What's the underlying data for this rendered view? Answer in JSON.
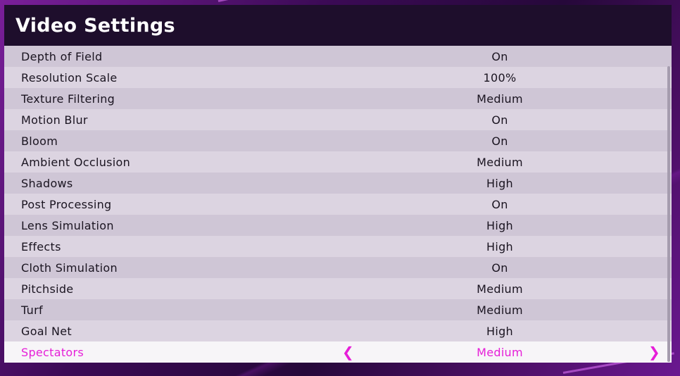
{
  "header": {
    "title": "Video Settings"
  },
  "settings": [
    {
      "label": "Depth of Field",
      "value": "On"
    },
    {
      "label": "Resolution Scale",
      "value": "100%"
    },
    {
      "label": "Texture Filtering",
      "value": "Medium"
    },
    {
      "label": "Motion Blur",
      "value": "On"
    },
    {
      "label": "Bloom",
      "value": "On"
    },
    {
      "label": "Ambient Occlusion",
      "value": "Medium"
    },
    {
      "label": "Shadows",
      "value": "High"
    },
    {
      "label": "Post Processing",
      "value": "On"
    },
    {
      "label": "Lens Simulation",
      "value": "High"
    },
    {
      "label": "Effects",
      "value": "High"
    },
    {
      "label": "Cloth Simulation",
      "value": "On"
    },
    {
      "label": "Pitchside",
      "value": "Medium"
    },
    {
      "label": "Turf",
      "value": "Medium"
    },
    {
      "label": "Goal Net",
      "value": "High"
    },
    {
      "label": "Spectators",
      "value": "Medium"
    }
  ],
  "selected": {
    "arrow_left": "❮",
    "arrow_right": "❯"
  },
  "colors": {
    "accent": "#e61ed8",
    "header_bg": "#1e0e2c",
    "row_odd": "#cfc6d6",
    "row_even": "#dcd4e1",
    "row_selected": "#f7f5f8"
  }
}
